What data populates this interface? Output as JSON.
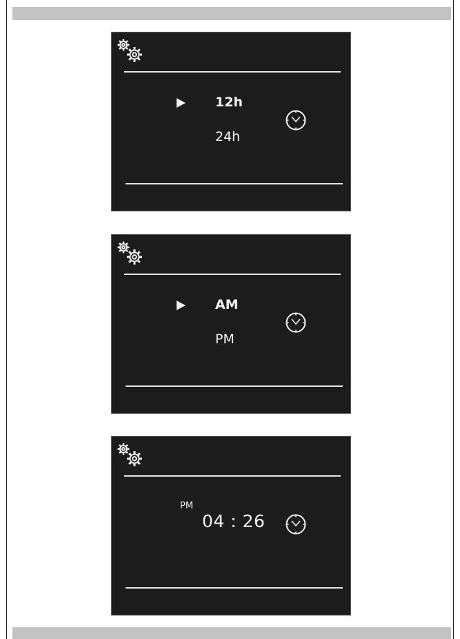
{
  "screens": {
    "hour_format": {
      "options": [
        "12h",
        "24h"
      ],
      "selected": "12h",
      "icon": "clock-icon",
      "header_icon": "settings-gears-icon"
    },
    "am_pm": {
      "options": [
        "AM",
        "PM"
      ],
      "selected": "AM",
      "icon": "clock-icon",
      "header_icon": "settings-gears-icon"
    },
    "time_set": {
      "period": "PM",
      "time": "04 : 26",
      "icon": "clock-icon",
      "header_icon": "settings-gears-icon"
    }
  },
  "colors": {
    "screen_background": "#1c1c1c",
    "screen_text": "#f2f2f2",
    "page_band": "#c3c3c3"
  }
}
